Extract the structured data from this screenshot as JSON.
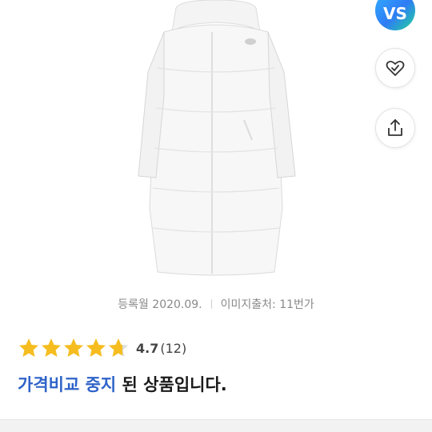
{
  "side_actions": {
    "vs_label": "VS"
  },
  "meta": {
    "registered": "등록월 2020.09.",
    "image_source": "이미지출처: 11번가"
  },
  "rating": {
    "score": "4.7",
    "count": "(12)",
    "stars_value": 4.7,
    "star_color": "#f5bd1f"
  },
  "notice": {
    "highlight": "가격비교 중지",
    "rest": " 된 상품입니다."
  },
  "colors": {
    "accent_blue": "#2f63c9",
    "vs_gradient_start": "#31b0ff",
    "vs_gradient_end": "#21d59a"
  }
}
